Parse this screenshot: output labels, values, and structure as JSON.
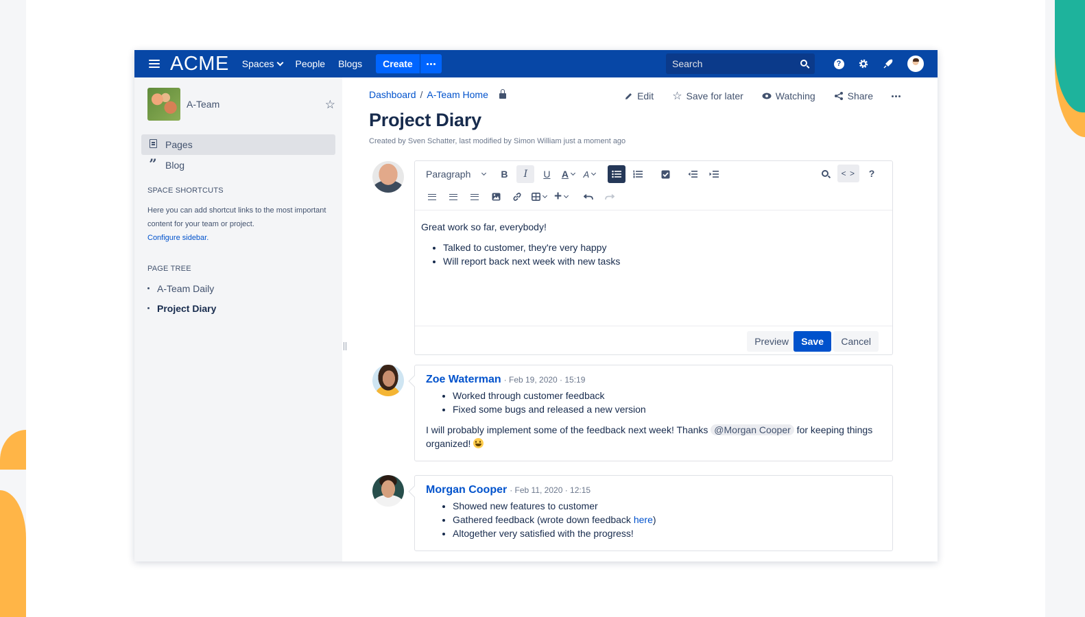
{
  "colors": {
    "topnav": "#0747a6",
    "create": "#0065ff",
    "primary": "#0052cc",
    "sidebar": "#f4f5f7",
    "accent_orange": "#ffb547",
    "accent_teal": "#1eb39c"
  },
  "topnav": {
    "logo": "ACME",
    "links": [
      "Spaces",
      "People",
      "Blogs"
    ],
    "create_label": "Create",
    "search_placeholder": "Search",
    "icons": [
      "menu-icon",
      "search-icon",
      "help-icon",
      "settings-icon",
      "notifications-icon",
      "user-avatar"
    ]
  },
  "sidebar": {
    "space_name": "A-Team",
    "items": [
      {
        "label": "Pages",
        "icon": "pages-icon",
        "active": true
      },
      {
        "label": "Blog",
        "icon": "quote-icon",
        "active": false
      }
    ],
    "shortcuts_title": "SPACE SHORTCUTS",
    "shortcuts_text": "Here you can add shortcut links to the most important content for your team or project.",
    "configure_link": "Configure sidebar.",
    "tree_title": "PAGE TREE",
    "tree": [
      {
        "label": "A-Team Daily",
        "current": false
      },
      {
        "label": "Project Diary",
        "current": true
      }
    ]
  },
  "page": {
    "breadcrumbs": [
      "Dashboard",
      "A-Team Home"
    ],
    "breadcrumb_sep": "/",
    "actions": {
      "edit": "Edit",
      "save_for_later": "Save for later",
      "watching": "Watching",
      "share": "Share"
    },
    "title": "Project Diary",
    "byline": "Created by Sven Schatter, last modified by Simon William just a moment ago"
  },
  "editor": {
    "paragraph_label": "Paragraph",
    "code_label": "< >",
    "help_label": "?",
    "body_intro": "Great work so far, everybody!",
    "body_items": [
      "Talked to customer, they're very happy",
      "Will report back next week with new tasks"
    ],
    "preview_label": "Preview",
    "save_label": "Save",
    "cancel_label": "Cancel"
  },
  "comments": [
    {
      "author": "Zoe Waterman",
      "meta": "· Feb 19, 2020 · 15:19",
      "items": [
        "Worked through customer feedback",
        "Fixed some bugs and released a new version"
      ],
      "text_before": "I will probably implement some of the feedback next week! Thanks ",
      "mention": "@Morgan Cooper",
      "text_after": " for keeping things organized! "
    },
    {
      "author": "Morgan Cooper",
      "meta": "· Feb 11, 2020 · 12:15",
      "items": [
        "Showed new features to customer",
        "Gathered feedback (wrote down feedback ",
        "Altogether very satisfied with the progress!"
      ],
      "link_text": "here",
      "link_after": ")"
    }
  ]
}
